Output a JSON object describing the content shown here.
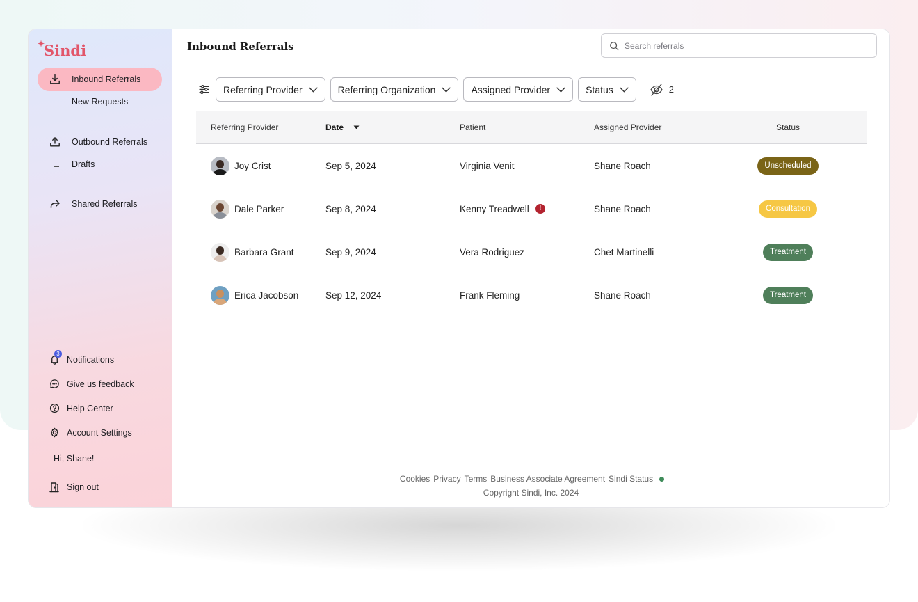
{
  "brand": {
    "name": "Sindi",
    "color": "#e2566a"
  },
  "sidebar": {
    "nav": [
      {
        "label": "Inbound Referrals",
        "icon": "inbox-download-icon",
        "active": true
      },
      {
        "label": "Outbound Referrals",
        "icon": "upload-icon",
        "active": false
      },
      {
        "label": "Shared Referrals",
        "icon": "share-arrow-icon",
        "active": false
      }
    ],
    "subnav": [
      {
        "label": "New Requests",
        "parent": "Inbound Referrals"
      },
      {
        "label": "Drafts",
        "parent": "Outbound Referrals"
      }
    ],
    "bottom": [
      {
        "label": "Notifications",
        "icon": "bell-icon",
        "badge": "3"
      },
      {
        "label": "Give us feedback",
        "icon": "chat-bubble-icon"
      },
      {
        "label": "Help Center",
        "icon": "question-circle-icon"
      },
      {
        "label": "Account Settings",
        "icon": "gear-icon"
      }
    ],
    "greeting": "Hi, Shane!",
    "sign_out": "Sign out"
  },
  "header": {
    "title": "Inbound Referrals",
    "search_placeholder": "Search referrals"
  },
  "filters": {
    "items": [
      "Referring Provider",
      "Referring Organization",
      "Assigned Provider",
      "Status"
    ],
    "hidden_count": "2"
  },
  "table": {
    "columns": [
      "Referring Provider",
      "Date",
      "Patient",
      "Assigned Provider",
      "Status"
    ],
    "sorted_by": "Date",
    "rows": [
      {
        "provider": "Joy Crist",
        "date": "Sep 5, 2024",
        "patient": "Virginia Venit",
        "patient_alert": false,
        "assigned": "Shane Roach",
        "status": "Unscheduled"
      },
      {
        "provider": "Dale Parker",
        "date": "Sep 8, 2024",
        "patient": "Kenny Treadwell",
        "patient_alert": true,
        "alert_symbol": "!",
        "assigned": "Shane Roach",
        "status": "Consultation"
      },
      {
        "provider": "Barbara Grant",
        "date": "Sep 9, 2024",
        "patient": "Vera Rodriguez",
        "patient_alert": false,
        "assigned": "Chet Martinelli",
        "status": "Treatment"
      },
      {
        "provider": "Erica Jacobson",
        "date": "Sep 12, 2024",
        "patient": "Frank Fleming",
        "patient_alert": false,
        "assigned": "Shane Roach",
        "status": "Treatment"
      }
    ]
  },
  "status_colors": {
    "Unscheduled": {
      "bg": "#7a6417",
      "fg": "#ffffff"
    },
    "Consultation": {
      "bg": "#f6c744",
      "fg": "#ffffff"
    },
    "Treatment": {
      "bg": "#4f7f5a",
      "fg": "#ffffff"
    }
  },
  "footer": {
    "links": [
      "Cookies",
      "Privacy",
      "Terms",
      "Business Associate Agreement",
      "Sindi Status"
    ],
    "status_color": "#3f8c5a",
    "copyright": "Copyright Sindi, Inc. 2024"
  }
}
